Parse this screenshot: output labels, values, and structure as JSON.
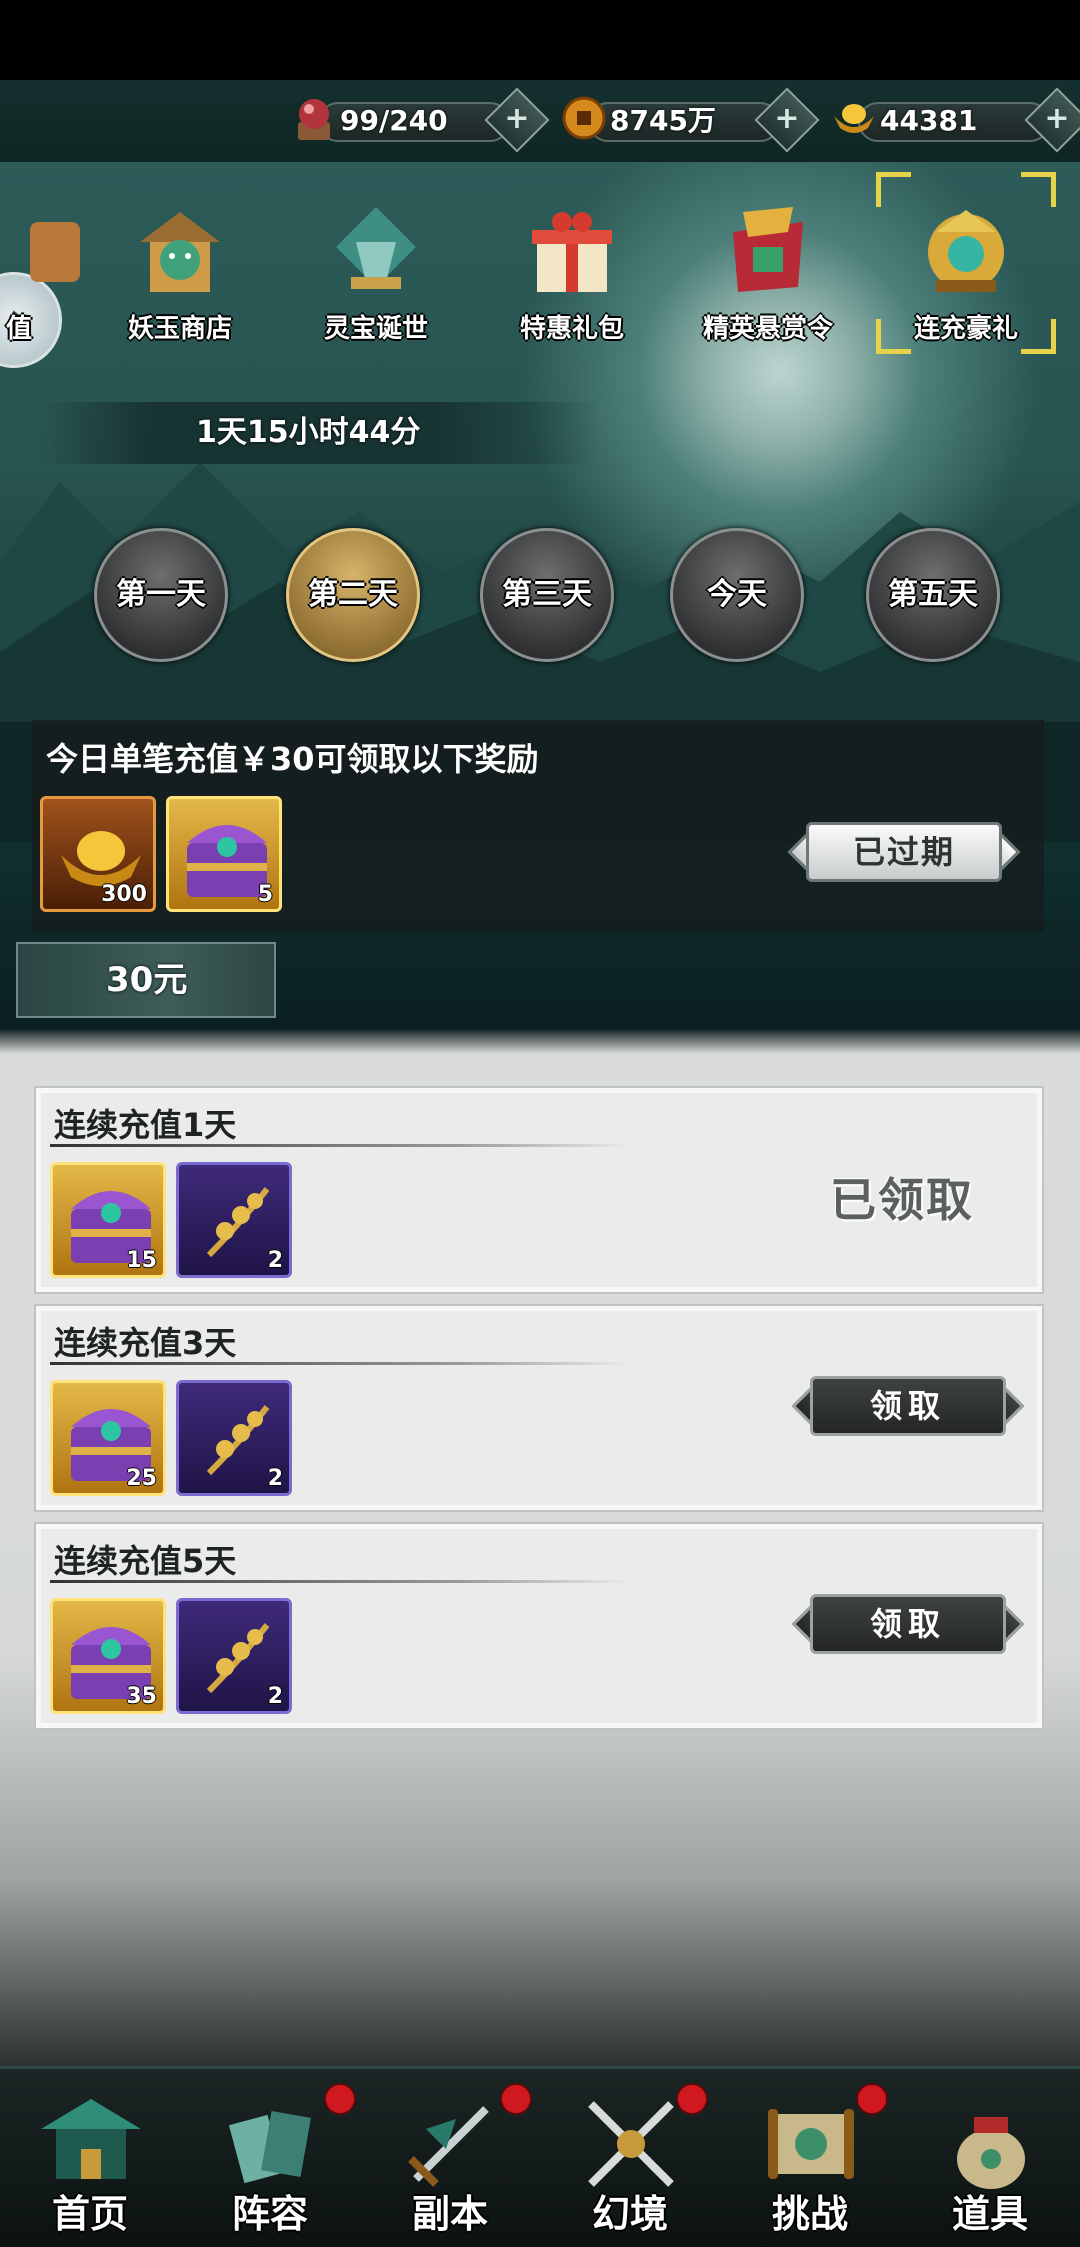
{
  "resources": [
    {
      "icon": "orb-icon",
      "value": "99/240"
    },
    {
      "icon": "coin-icon",
      "value": "8745万"
    },
    {
      "icon": "gold-ingot-icon",
      "value": "44381"
    }
  ],
  "tabs": [
    {
      "label": "值",
      "icon": "partial-tab-icon"
    },
    {
      "label": "妖玉商店",
      "icon": "shop-icon"
    },
    {
      "label": "灵宝诞世",
      "icon": "treasure-icon"
    },
    {
      "label": "特惠礼包",
      "icon": "gift-box-icon"
    },
    {
      "label": "精英悬赏令",
      "icon": "bounty-icon"
    },
    {
      "label": "连充豪礼",
      "icon": "jade-treasure-icon"
    }
  ],
  "countdown": "1天15小时44分",
  "days": [
    "第一天",
    "第二天",
    "第三天",
    "今天",
    "第五天"
  ],
  "offer": {
    "text": "今日单笔充值￥30可领取以下奖励",
    "items": [
      {
        "name": "gold-ingot",
        "count": "300"
      },
      {
        "name": "treasure-chest",
        "count": "5"
      }
    ],
    "button": "已过期",
    "amount": "30元"
  },
  "tasks": [
    {
      "title": "连续充值1天",
      "items": [
        {
          "name": "treasure-chest",
          "count": "15"
        },
        {
          "name": "golden-herb",
          "count": "2"
        }
      ],
      "status": "已领取"
    },
    {
      "title": "连续充值3天",
      "items": [
        {
          "name": "treasure-chest",
          "count": "25"
        },
        {
          "name": "golden-herb",
          "count": "2"
        }
      ],
      "button": "领取"
    },
    {
      "title": "连续充值5天",
      "items": [
        {
          "name": "treasure-chest",
          "count": "35"
        },
        {
          "name": "golden-herb",
          "count": "2"
        }
      ],
      "button": "领取"
    }
  ],
  "nav": [
    {
      "label": "首页",
      "icon": "home-pavilion-icon"
    },
    {
      "label": "阵容",
      "icon": "lineup-icon"
    },
    {
      "label": "副本",
      "icon": "dungeon-sword-icon"
    },
    {
      "label": "幻境",
      "icon": "crossed-swords-icon"
    },
    {
      "label": "挑战",
      "icon": "scroll-icon"
    },
    {
      "label": "道具",
      "icon": "item-bag-icon"
    }
  ],
  "colors": {
    "accent": "#e6d34a",
    "badge": "#d0191f",
    "panel": "#161c1e"
  }
}
